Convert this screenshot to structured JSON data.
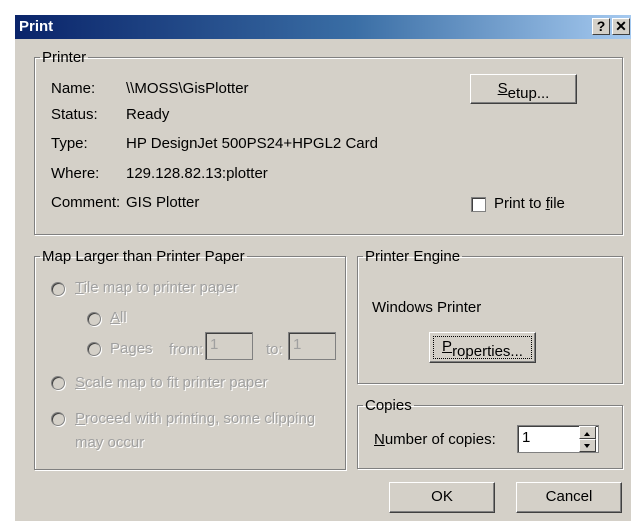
{
  "window": {
    "title": "Print",
    "help_btn": "?",
    "close_btn": "✕"
  },
  "printer": {
    "group_label": "Printer",
    "name_label": "Name:",
    "name_value": "\\\\MOSS\\GisPlotter",
    "status_label": "Status:",
    "status_value": "Ready",
    "type_label": "Type:",
    "type_value": "HP DesignJet 500PS24+HPGL2 Card",
    "where_label": "Where:",
    "where_value": "129.128.82.13:plotter",
    "comment_label": "Comment:",
    "comment_value": "GIS Plotter",
    "setup_button": {
      "pre": "",
      "accel": "S",
      "post": "etup..."
    },
    "print_to_file": {
      "pre": "Print to ",
      "accel": "f",
      "post": "ile",
      "checked": false
    }
  },
  "map_larger": {
    "group_label": "Map Larger than Printer Paper",
    "tile": {
      "pre": "",
      "accel": "T",
      "post": "ile map to printer paper"
    },
    "all": {
      "pre": "",
      "accel": "A",
      "post": "ll"
    },
    "pages": {
      "label": "Pages",
      "from_label": "from:",
      "from_value": "1",
      "to_label": "to:",
      "to_value": "1"
    },
    "scale": {
      "pre": "",
      "accel": "S",
      "post": "cale map to fit printer paper"
    },
    "proceed": {
      "pre": "",
      "accel": "P",
      "post": "roceed with printing, some clipping",
      "line2": "may occur"
    }
  },
  "engine": {
    "group_label": "Printer Engine",
    "name": "Windows Printer",
    "properties_button": {
      "pre": "",
      "accel": "P",
      "post": "roperties..."
    }
  },
  "copies": {
    "group_label": "Copies",
    "label": {
      "pre": "",
      "accel": "N",
      "post": "umber of copies:"
    },
    "value": "1"
  },
  "footer": {
    "ok_label": "OK",
    "cancel_label": "Cancel"
  }
}
